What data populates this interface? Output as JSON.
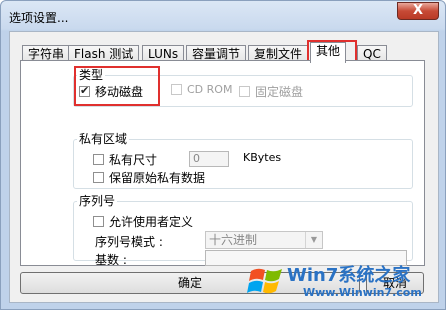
{
  "window": {
    "title": "选项设置...",
    "close_glyph": "X"
  },
  "tabs": [
    {
      "label": "字符串"
    },
    {
      "label": "Flash 测试"
    },
    {
      "label": "LUNs"
    },
    {
      "label": "容量调节"
    },
    {
      "label": "复制文件"
    },
    {
      "label": "其他"
    },
    {
      "label": "QC"
    }
  ],
  "type_group": {
    "legend": "类型",
    "removable_disk": {
      "label": "移动磁盘",
      "checked": true
    },
    "cd_rom": {
      "label": "CD ROM",
      "checked": false
    },
    "fixed_disk": {
      "label": "固定磁盘",
      "checked": false
    }
  },
  "private_group": {
    "legend": "私有区域",
    "private_size": {
      "label": "私有尺寸",
      "checked": false
    },
    "size_value": "0",
    "size_unit": "KBytes",
    "keep_data": {
      "label": "保留原始私有数据",
      "checked": false
    }
  },
  "serial_group": {
    "legend": "序列号",
    "allow_user_defined": {
      "label": "允许使用者定义",
      "checked": false
    },
    "mode_label": "序列号模式 :",
    "mode_value": "十六进制",
    "base_label": "基数 :",
    "base_value": ""
  },
  "buttons": {
    "ok": "确定",
    "cancel": "取消"
  },
  "watermark": {
    "brand": "Win7系统之家",
    "url": "Www.Winwin7.com"
  },
  "colors": {
    "highlight": "#e0302e",
    "watermark": "#2a72c4"
  }
}
